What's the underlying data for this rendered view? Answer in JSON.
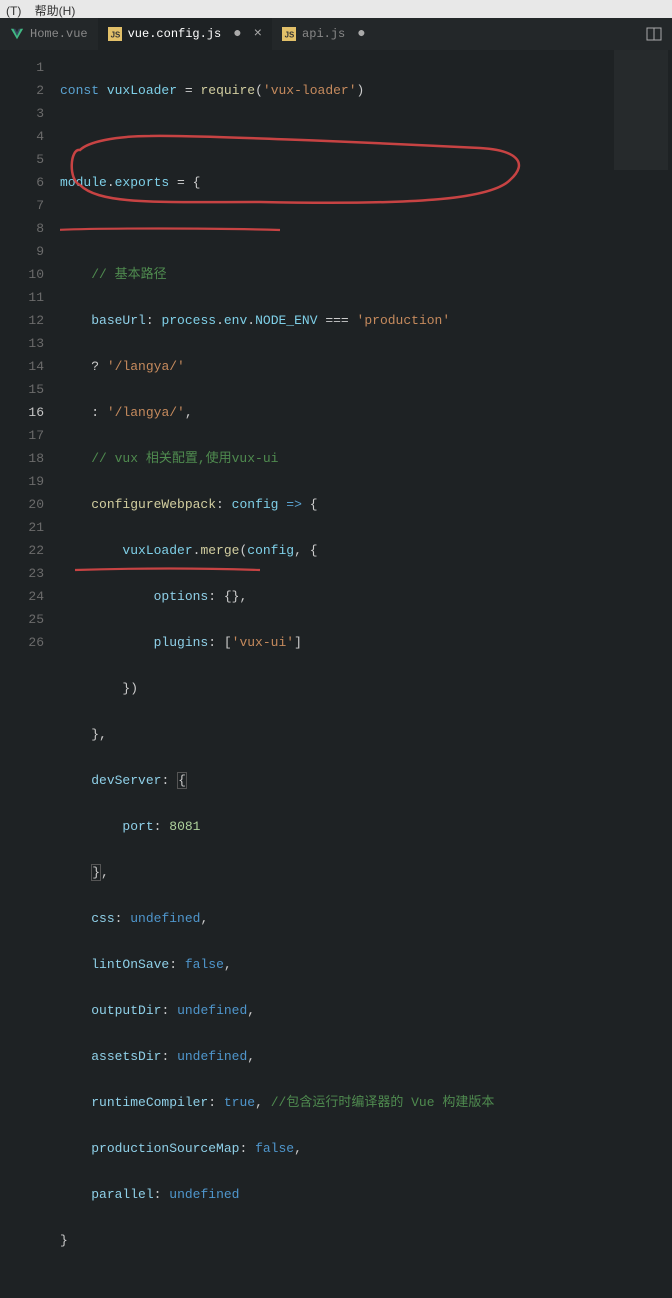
{
  "menubar": {
    "items": [
      "(T)",
      "帮助(H)"
    ]
  },
  "tabs": {
    "list": [
      {
        "icon": "vue",
        "label": "Home.vue",
        "active": false,
        "dirty": false
      },
      {
        "icon": "js",
        "label": "vue.config.js",
        "active": true,
        "dirty": true
      },
      {
        "icon": "js",
        "label": "api.js",
        "active": false,
        "dirty": true
      }
    ]
  },
  "editor": {
    "currentLine": 16,
    "lines": [
      1,
      2,
      3,
      4,
      5,
      6,
      7,
      8,
      9,
      10,
      11,
      12,
      13,
      14,
      15,
      16,
      17,
      18,
      19,
      20,
      21,
      22,
      23,
      24,
      25,
      26
    ]
  },
  "code": {
    "l1": {
      "kw": "const",
      "var": "vuxLoader",
      "fn": "require",
      "str": "'vux-loader'"
    },
    "l3a": "module",
    "l3b": "exports",
    "l5_cmt": "// 基本路径",
    "l6": {
      "prop": "baseUrl",
      "obj": "process",
      "env": "env",
      "node": "NODE_ENV",
      "op": "===",
      "str": "'production'"
    },
    "l7_str": "'/langya/'",
    "l8_str": "'/langya/'",
    "l9_cmt": "// vux 相关配置,使用vux-ui",
    "l10": {
      "prop": "configureWebpack",
      "param": "config"
    },
    "l11": {
      "obj": "vuxLoader",
      "fn": "merge",
      "arg": "config"
    },
    "l12": {
      "prop": "options"
    },
    "l13": {
      "prop": "plugins",
      "str": "'vux-ui'"
    },
    "l16_prop": "devServer",
    "l17": {
      "prop": "port",
      "num": "8081"
    },
    "l19": {
      "prop": "css",
      "val": "undefined"
    },
    "l20": {
      "prop": "lintOnSave",
      "val": "false"
    },
    "l21": {
      "prop": "outputDir",
      "val": "undefined"
    },
    "l22": {
      "prop": "assetsDir",
      "val": "undefined"
    },
    "l23": {
      "prop": "runtimeCompiler",
      "val": "true",
      "cmt": "//包含运行时编译器的 Vue 构建版本"
    },
    "l24": {
      "prop": "productionSourceMap",
      "val": "false"
    },
    "l25": {
      "prop": "parallel",
      "val": "undefined"
    }
  },
  "icons": {
    "vue_color": "#41b883",
    "js_color": "#e2c069"
  },
  "annotation": {
    "color": "#c74343"
  }
}
